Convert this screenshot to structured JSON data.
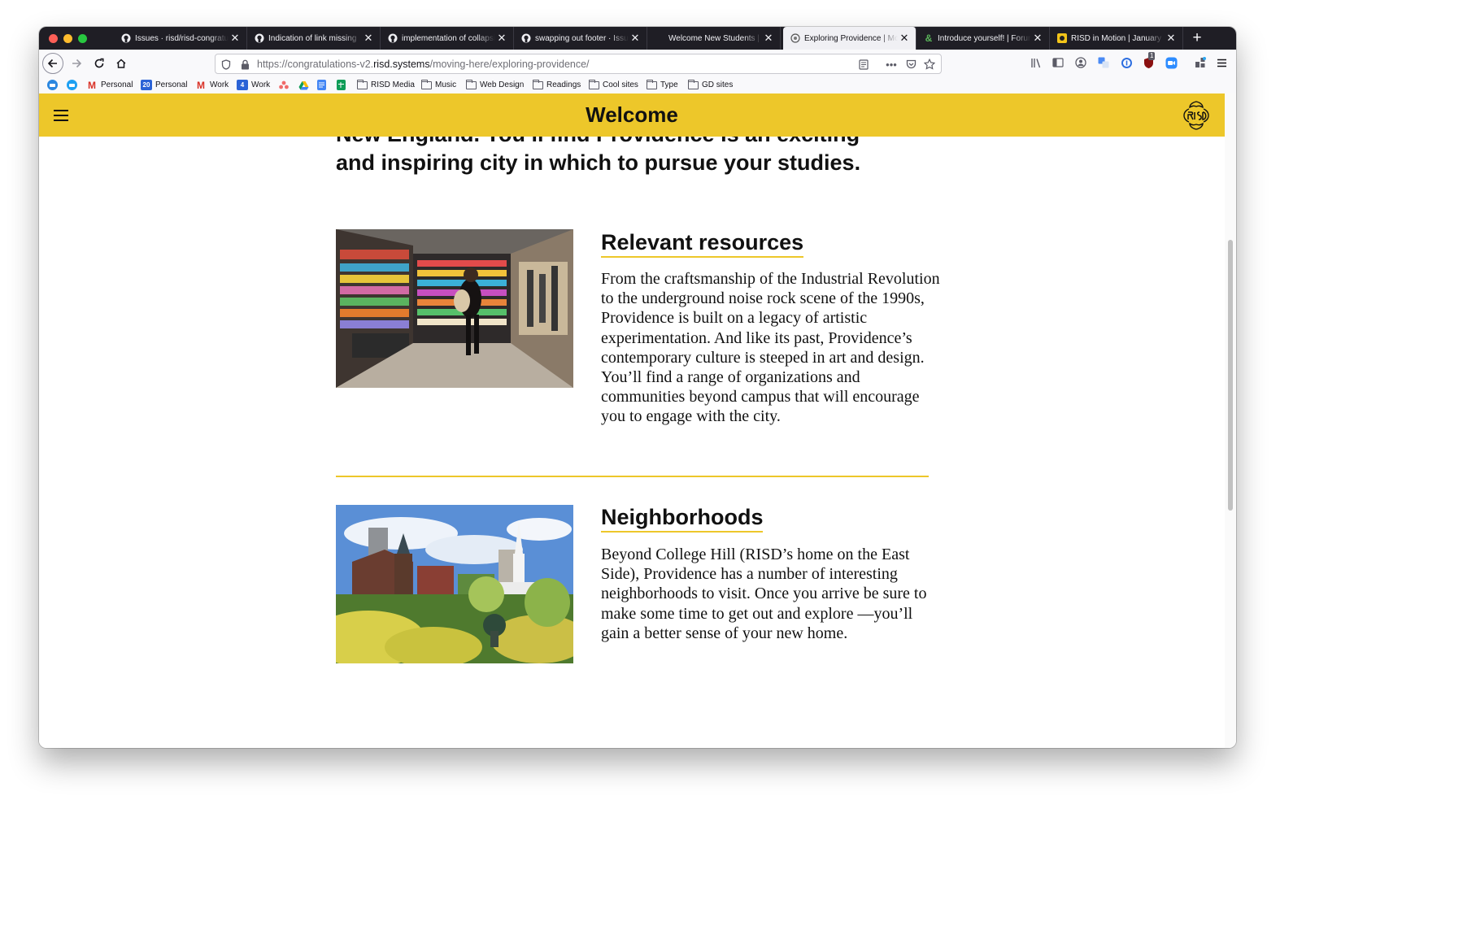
{
  "browser": {
    "tabs": [
      {
        "title": "Issues · risd/risd-congratulations",
        "icon": "github-icon"
      },
      {
        "title": "Indication of link missing",
        "icon": "github-icon"
      },
      {
        "title": "implementation of collapsible",
        "icon": "github-icon"
      },
      {
        "title": "swapping out footer · Issue",
        "icon": "github-icon"
      },
      {
        "title": "Welcome New Students | RISD",
        "icon": ""
      },
      {
        "title": "Exploring Providence | Moving Here",
        "icon": "risd-seal-icon",
        "active": true
      },
      {
        "title": "Introduce yourself! | Forum",
        "icon": "ampersand-icon"
      },
      {
        "title": "RISD in Motion | January",
        "icon": "yellow-square-icon"
      }
    ],
    "url_prefix": "https://congratulations-v2.",
    "url_domain": "risd.systems",
    "url_path": "/moving-here/exploring-providence/",
    "extension_badge": "1",
    "bookmarks": [
      {
        "label": "",
        "icon": "blue-circle-icon"
      },
      {
        "label": "",
        "icon": "blue-chat-icon"
      },
      {
        "label": "Personal",
        "icon": "gmail-icon"
      },
      {
        "label": "Personal",
        "icon": "calendar-icon",
        "badge": "20"
      },
      {
        "label": "Work",
        "icon": "gmail-icon"
      },
      {
        "label": "Work",
        "icon": "calendar-icon",
        "badge": "4"
      },
      {
        "label": "",
        "icon": "asana-icon"
      },
      {
        "label": "",
        "icon": "drive-icon"
      },
      {
        "label": "",
        "icon": "docs-icon"
      },
      {
        "label": "",
        "icon": "sheets-icon"
      },
      {
        "label": "RISD Media",
        "icon": "folder-icon"
      },
      {
        "label": "Music",
        "icon": "folder-icon"
      },
      {
        "label": "Web Design",
        "icon": "folder-icon"
      },
      {
        "label": "Readings",
        "icon": "folder-icon"
      },
      {
        "label": "Cool sites",
        "icon": "folder-icon"
      },
      {
        "label": "Type",
        "icon": "folder-icon"
      },
      {
        "label": "GD sites",
        "icon": "folder-icon"
      }
    ]
  },
  "site": {
    "title": "Welcome",
    "brand_color": "#edc72a",
    "intro_line1": "New England. You’ll find Providence is an exciting",
    "intro_line2": "and inspiring city in which to pursue your studies.",
    "sections": [
      {
        "title": "Relevant resources",
        "body": "From the craftsmanship of the Industrial Revolution to the underground noise rock scene of the 1990s, Providence is built on a legacy of artistic experimentation. And like its past, Providence’s contemporary culture is steeped in art and design. You’ll find a range of organizations and communities beyond campus that will encourage you to engage with the city."
      },
      {
        "title": "Neighborhoods",
        "body": "Beyond College Hill (RISD’s home on the East Side), Providence has a number of interesting neighborhoods to visit. Once you arrive be sure to make some time to get out and explore —you’ll gain a better sense of your new home."
      }
    ]
  }
}
